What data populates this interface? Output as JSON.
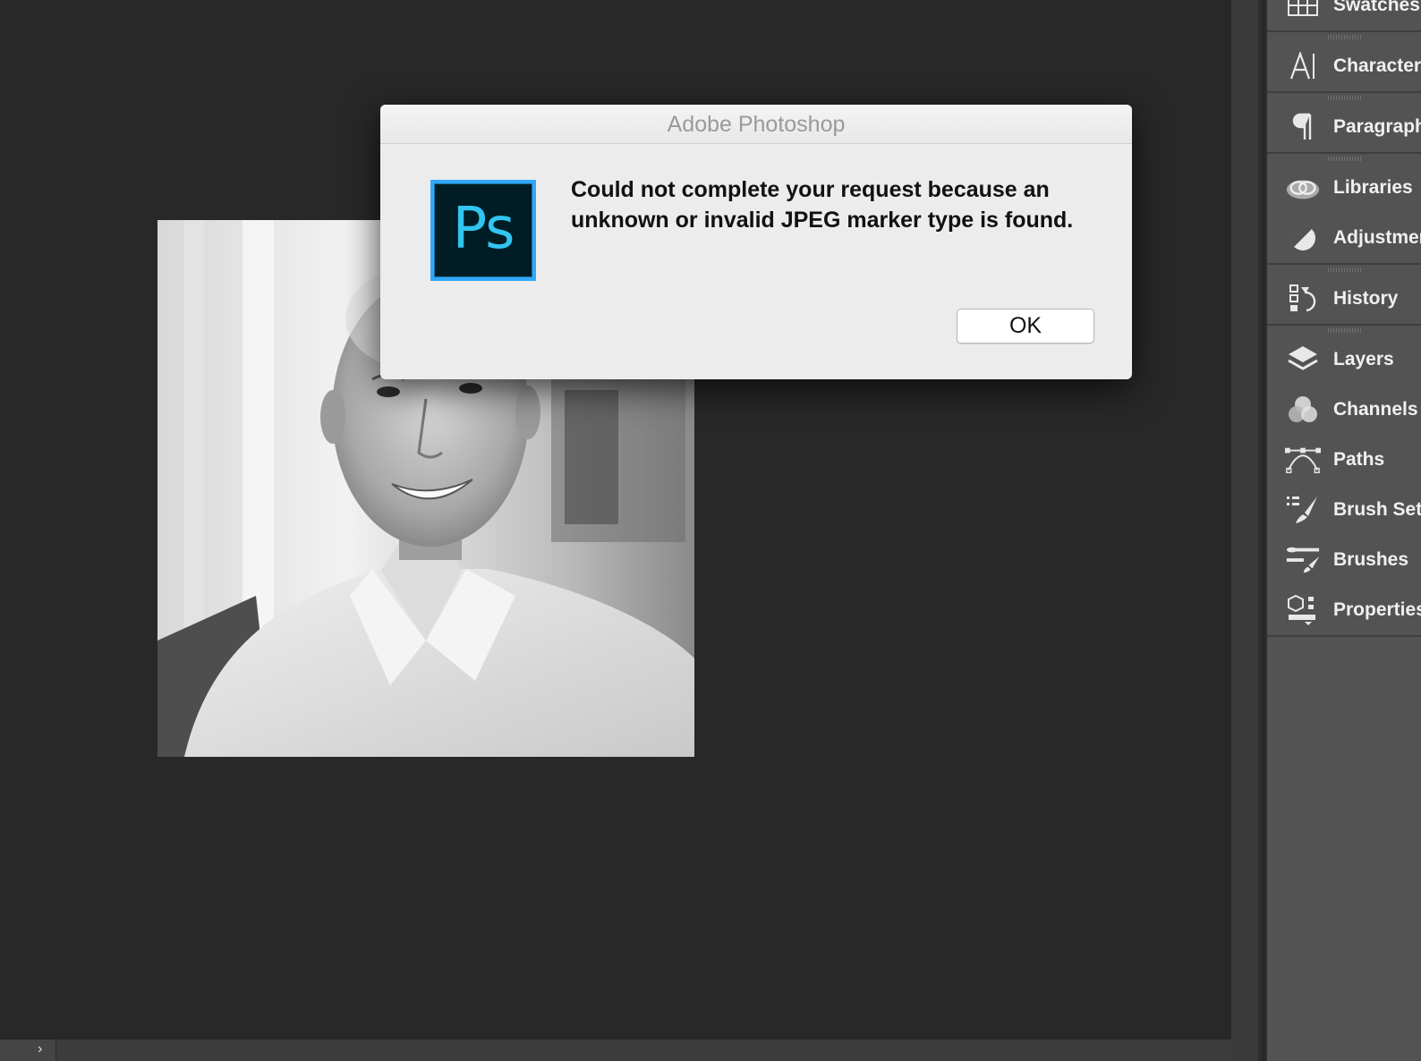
{
  "dialog": {
    "title": "Adobe Photoshop",
    "app_icon_text": "Ps",
    "message": "Could not complete your request because an unknown or invalid JPEG marker type is found.",
    "ok_label": "OK"
  },
  "statusbar": {
    "expand_glyph": "›"
  },
  "panels": {
    "swatches": "Swatches",
    "character": "Character",
    "paragraph": "Paragraph",
    "libraries": "Libraries",
    "adjustments": "Adjustments",
    "history": "History",
    "layers": "Layers",
    "channels": "Channels",
    "paths": "Paths",
    "brush_settings": "Brush Settings",
    "brushes": "Brushes",
    "properties": "Properties"
  },
  "colors": {
    "canvas_bg": "#282828",
    "panel_bg": "#535353",
    "ps_blue": "#31a8ff",
    "ps_dark": "#001d26"
  }
}
